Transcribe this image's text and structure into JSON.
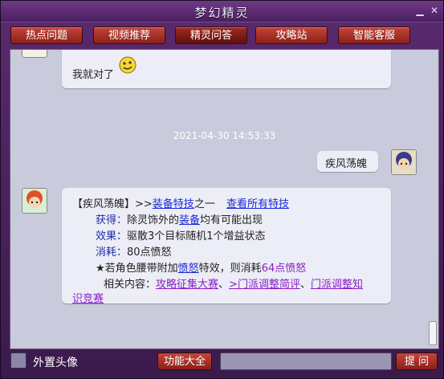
{
  "window": {
    "title": "梦幻精灵"
  },
  "tabs": [
    {
      "label": "热点问题"
    },
    {
      "label": "视频推荐"
    },
    {
      "label": "精灵问答"
    },
    {
      "label": "攻略站"
    },
    {
      "label": "智能客服"
    }
  ],
  "chat": {
    "prev_message": "我就对了",
    "timestamp": "2021-04-30 14:53:33",
    "user_message": "疾风荡魄",
    "answer": {
      "title_prefix": "【疾风荡魄】>>",
      "title_link": "装备特技",
      "title_suffix": "之一",
      "view_all": "查看所有特技",
      "get_label": "获得：",
      "get_text_1": "除灵饰外的",
      "get_link": "装备",
      "get_text_2": "均有可能出现",
      "effect_label": "效果：",
      "effect_text": "驱散3个目标随机1个增益状态",
      "cost_label": "消耗：",
      "cost_text": "80点愤怒",
      "note_1": "★若角色腰带附加",
      "note_link": "愤怒",
      "note_2": "特效，则消耗",
      "note_value": "64点愤怒",
      "related_label": "相关内容：",
      "related_1": "攻略征集大赛",
      "sep": "、",
      "related_2": ">门派调整简评",
      "related_3a": "门派调整知",
      "related_3b": "识竞赛"
    }
  },
  "bottom": {
    "avatar_checkbox_label": "外置头像",
    "functions_button": "功能大全",
    "input_value": "",
    "ask_button": "提 问"
  }
}
